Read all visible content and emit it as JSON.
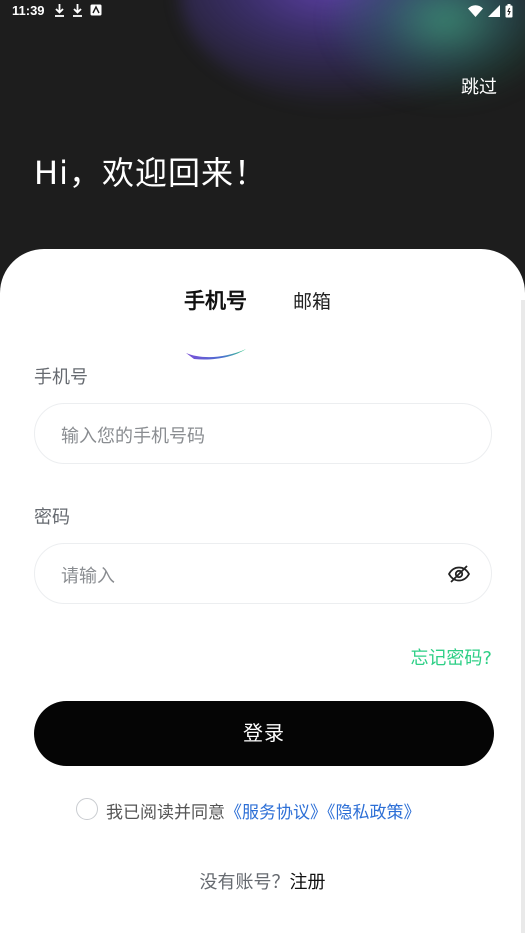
{
  "status_bar": {
    "time": "11:39"
  },
  "header": {
    "skip_label": "跳过",
    "greeting": "Hi，欢迎回来！"
  },
  "tabs": {
    "phone_label": "手机号",
    "email_label": "邮箱"
  },
  "form": {
    "phone_label": "手机号",
    "phone_placeholder": "输入您的手机号码",
    "password_label": "密码",
    "password_placeholder": "请输入",
    "forgot_label": "忘记密码?",
    "login_label": "登录"
  },
  "agreement": {
    "prefix": "我已阅读并同意",
    "service_link": "《服务协议》",
    "privacy_link": "《隐私政策》"
  },
  "register": {
    "prompt": "没有账号？",
    "link": "注册"
  },
  "colors": {
    "accent_green": "#2ecf86",
    "link_blue": "#2d6fd6",
    "button_black": "#050505"
  }
}
